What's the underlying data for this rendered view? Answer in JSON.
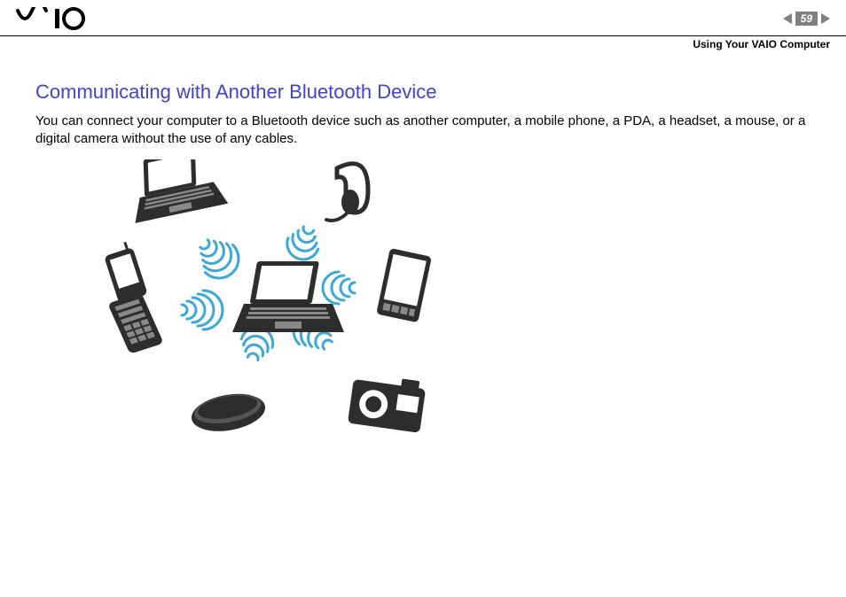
{
  "header": {
    "logo_alt": "VAIO",
    "page_number": "59",
    "section": "Using Your VAIO Computer"
  },
  "content": {
    "title": "Communicating with Another Bluetooth Device",
    "body": "You can connect your computer to a Bluetooth device such as another computer, a mobile phone, a PDA, a headset, a mouse, or a digital camera without the use of any cables."
  },
  "diagram": {
    "center_device": "laptop",
    "connected_devices": [
      "laptop",
      "headset",
      "pda",
      "camera",
      "mouse",
      "flip-phone"
    ],
    "signal_color": "#3aa8d8"
  }
}
